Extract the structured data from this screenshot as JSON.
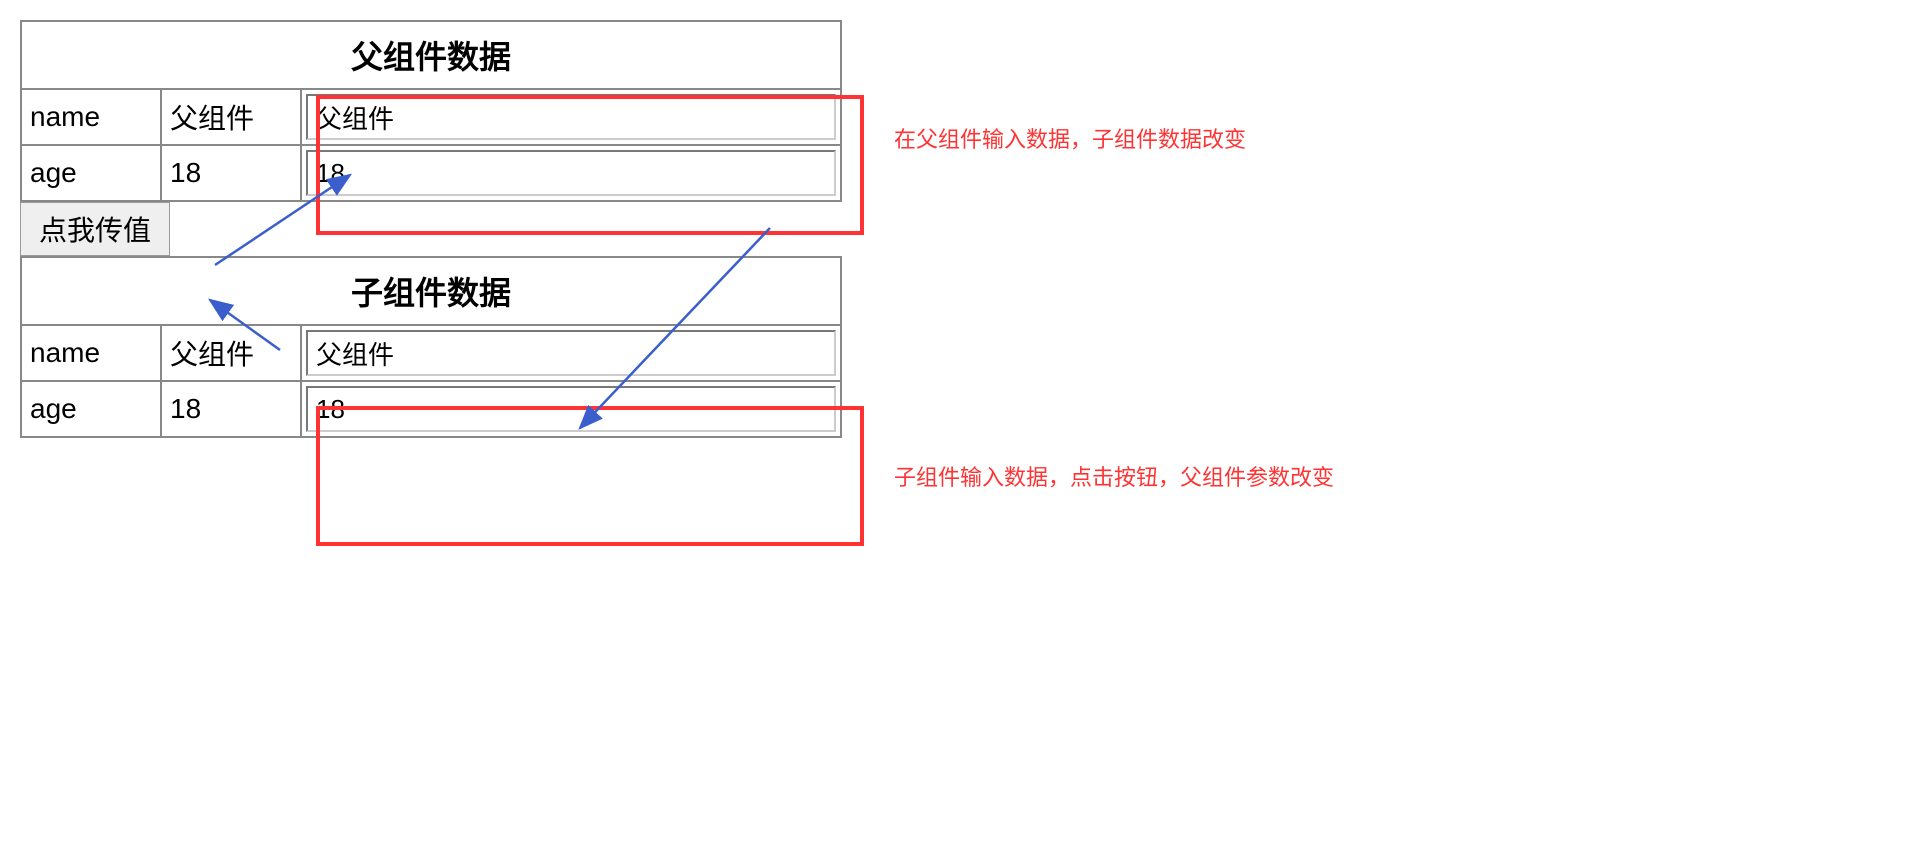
{
  "parent_table": {
    "title": "父组件数据",
    "rows": [
      {
        "label": "name",
        "value": "父组件",
        "input_value": "父组件"
      },
      {
        "label": "age",
        "value": "18",
        "input_value": "18"
      }
    ]
  },
  "button": {
    "label": "点我传值"
  },
  "child_table": {
    "title": "子组件数据",
    "rows": [
      {
        "label": "name",
        "value": "父组件",
        "input_value": "父组件"
      },
      {
        "label": "age",
        "value": "18",
        "input_value": "18"
      }
    ]
  },
  "annotations": {
    "top": "在父组件输入数据，子组件数据改变",
    "bottom": "子组件输入数据，点击按钮，父组件参数改变"
  },
  "colors": {
    "highlight_border": "#ff3333",
    "annotation_text": "#ff3333",
    "arrow": "#3a5fcd"
  }
}
